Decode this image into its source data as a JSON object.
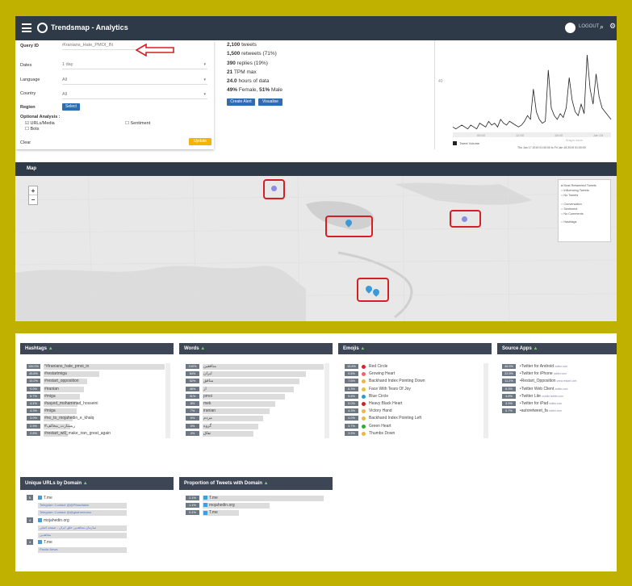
{
  "app": {
    "title": "Trendsmap - Analytics",
    "logout_label": "LOGOUT"
  },
  "query_form": {
    "query_label": "Query ID",
    "query_value": "#Iranians_Hate_PMOI_IN",
    "dates_label": "Dates",
    "dates_value": "1 day",
    "language_label": "Language",
    "language_value": "All",
    "country_label": "Country",
    "country_value": "All",
    "region_label": "Region",
    "region_button": "Select",
    "optional_label": "Optional Analysis :",
    "opt_urls": "URLs/Media",
    "opt_bots": "Bots",
    "opt_sentiment": "Sentiment",
    "clear_label": "Clear",
    "update_button": "Update"
  },
  "stats": {
    "tweets": "2,100",
    "tweets_label": "tweets",
    "retweets": "1,500",
    "retweets_label": "retweets (71%)",
    "replies": "390",
    "replies_label": "replies (19%)",
    "tpm": "21",
    "tpm_label": "TPM max",
    "hours": "24.0",
    "hours_label": "hours of data",
    "female_pct": "49%",
    "female_label": "Female,",
    "male_pct": "51%",
    "male_label": "Male",
    "create_alert": "Create Alert",
    "visualise": "Visualise"
  },
  "timeline": {
    "ylabel": "40",
    "legend_label": "Tweet Volume",
    "range_text": "Thu Jan 17 2019 01:00:00 to Fri Jan 18 2019 01:00:00",
    "brush_text": "Drag to zoom",
    "ticks": [
      "06:00",
      "12:00",
      "18:00",
      "Jan 18"
    ],
    "series": [
      2,
      1,
      2,
      3,
      2,
      1,
      3,
      2,
      1,
      4,
      3,
      2,
      5,
      3,
      4,
      2,
      6,
      4,
      3,
      5,
      4,
      3,
      2,
      3,
      5,
      8,
      6,
      22,
      10,
      6,
      4,
      5,
      32,
      12,
      8,
      6,
      9,
      7,
      12,
      28,
      16,
      10,
      8,
      14,
      9,
      40,
      22,
      14,
      30,
      18,
      12,
      10,
      8,
      6
    ]
  },
  "map": {
    "header": "Map",
    "legend_items": [
      "Most Retweeted Tweets",
      "Influencing Tweets",
      "No Tweets",
      "Conversation",
      "Sentiment",
      "No Comments",
      "Hashtags"
    ]
  },
  "hashtags": {
    "header": "Hashtags",
    "rows": [
      {
        "pct": "100.0%",
        "label": "*#Iranians_hate_pmoi_in",
        "w": 1.0
      },
      {
        "pct": "45.8%",
        "label": "#restartmiga",
        "w": 0.46
      },
      {
        "pct": "10.2%",
        "label": "#restart_opposition",
        "w": 0.36
      },
      {
        "pct": "9.0%",
        "label": "#iranian",
        "w": 0.33
      },
      {
        "pct": "5.7%",
        "label": "#miga",
        "w": 0.3
      },
      {
        "pct": "4.4%",
        "label": "#sayed_mohammad_hosseini",
        "w": 0.28
      },
      {
        "pct": "4.3%",
        "label": "#miga",
        "w": 0.27
      },
      {
        "pct": "3.0%",
        "label": "#no_to_mojahedin_e_khalq",
        "w": 0.24
      },
      {
        "pct": "2.9%",
        "label": "#ریستارت_مخالف",
        "w": 0.22
      },
      {
        "pct": "2.8%",
        "label": "#restart_will_make_iran_great_again",
        "w": 0.2
      }
    ]
  },
  "words": {
    "header": "Words",
    "rows": [
      {
        "pct": "100%",
        "label": "منافقین",
        "w": 1.0
      },
      {
        "pct": "64%",
        "label": "ایران",
        "w": 0.85
      },
      {
        "pct": "52%",
        "label": "منافق",
        "w": 0.8
      },
      {
        "pct": "46%",
        "label": "از",
        "w": 0.75
      },
      {
        "pct": "31%",
        "label": "pmoi",
        "w": 0.68
      },
      {
        "pct": "8%",
        "label": "mek",
        "w": 0.6
      },
      {
        "pct": "7%",
        "label": "iranian",
        "w": 0.55
      },
      {
        "pct": "6%",
        "label": "مردم",
        "w": 0.5
      },
      {
        "pct": "5%",
        "label": "گروه",
        "w": 0.46
      },
      {
        "pct": "4%",
        "label": "نفاق",
        "w": 0.42
      }
    ]
  },
  "emojis": {
    "header": "Emojis",
    "rows": [
      {
        "pct": "15.8%",
        "label": "Red Circle",
        "color": "#d22"
      },
      {
        "pct": "9.8%",
        "label": "Growing Heart",
        "color": "#e66"
      },
      {
        "pct": "7.6%",
        "label": "Backhand Index Pointing Down",
        "color": "#e8b84a"
      },
      {
        "pct": "6.3%",
        "label": "Face With Tears Of Joy",
        "color": "#e8c040"
      },
      {
        "pct": "5.8%",
        "label": "Blue Circle",
        "color": "#39c"
      },
      {
        "pct": "5.0%",
        "label": "Heavy Black Heart",
        "color": "#c22"
      },
      {
        "pct": "4.3%",
        "label": "Victory Hand",
        "color": "#e8b84a"
      },
      {
        "pct": "4.0%",
        "label": "Backhand Index Pointing Left",
        "color": "#e8b84a"
      },
      {
        "pct": "3.7%",
        "label": "Green Heart",
        "color": "#3a3"
      },
      {
        "pct": "3.5%",
        "label": "Thumbs Down",
        "color": "#e8b84a"
      }
    ]
  },
  "source_apps": {
    "header": "Source Apps",
    "rows": [
      {
        "pct": "46.9%",
        "label": "Twitter for Android",
        "sub": "twitter.com"
      },
      {
        "pct": "22.9%",
        "label": "Twitter for iPhone",
        "sub": "twitter.com"
      },
      {
        "pct": "11.2%",
        "label": "Restart_Opposition",
        "sub": "www.restart.com"
      },
      {
        "pct": "6.3%",
        "label": "Twitter Web Client",
        "sub": "twitter.com"
      },
      {
        "pct": "4.8%",
        "label": "Twitter Lite",
        "sub": "mobile.twitter.com"
      },
      {
        "pct": "3.9%",
        "label": "Twitter for iPad",
        "sub": "twitter.com"
      },
      {
        "pct": "0.7%",
        "label": "autoretweet_fa",
        "sub": "twitter.com"
      }
    ]
  },
  "urls": {
    "header": "Unique URLs by Domain",
    "groups": [
      {
        "num": "5",
        "domain": "T.me",
        "links": [
          "Telegram: Contact @@Pfanzilalon",
          "Telegram: Contact @@ghahremanu"
        ]
      },
      {
        "num": "4",
        "domain": "mojahedin.org",
        "links": [
          "سازمان مجاهدین خلق ایران - صفحه اصلی",
          "مجاهدین"
        ]
      },
      {
        "num": "3",
        "domain": "T.me",
        "links": [
          "Pardis News"
        ]
      }
    ]
  },
  "domains": {
    "header": "Proportion of Tweets with Domain",
    "rows": [
      {
        "pct": "2.1%",
        "label": "T.me",
        "w": 1.0
      },
      {
        "pct": "1.1%",
        "label": "mojahedin.org",
        "w": 0.55
      },
      {
        "pct": "0.4%",
        "label": "T.me",
        "w": 0.3
      }
    ]
  }
}
